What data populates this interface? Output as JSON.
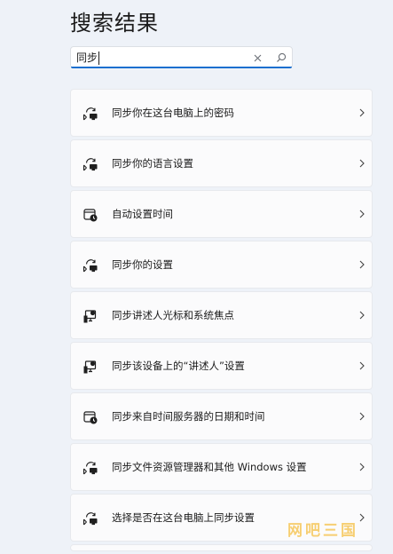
{
  "page": {
    "title": "搜索结果"
  },
  "search": {
    "value": "同步",
    "clear_icon": "close-icon",
    "search_icon": "search-icon"
  },
  "results": [
    {
      "label": "同步你在这台电脑上的密码",
      "icon": "sync-pc-icon"
    },
    {
      "label": "同步你的语言设置",
      "icon": "sync-pc-icon"
    },
    {
      "label": "自动设置时间",
      "icon": "calendar-clock-icon"
    },
    {
      "label": "同步你的设置",
      "icon": "sync-pc-icon"
    },
    {
      "label": "同步讲述人光标和系统焦点",
      "icon": "narrator-monitor-icon"
    },
    {
      "label": "同步该设备上的“讲述人”设置",
      "icon": "narrator-monitor-icon"
    },
    {
      "label": "同步来自时间服务器的日期和时间",
      "icon": "calendar-clock-icon"
    },
    {
      "label": "同步文件资源管理器和其他 Windows 设置",
      "icon": "sync-pc-icon"
    },
    {
      "label": "选择是否在这台电脑上同步设置",
      "icon": "sync-pc-icon"
    }
  ],
  "watermark": {
    "text": "网吧三国"
  },
  "colors": {
    "background": "#eef2f8",
    "card": "#fbfbfc",
    "accent": "#1a6fcf",
    "watermark": "#f6c75a"
  }
}
